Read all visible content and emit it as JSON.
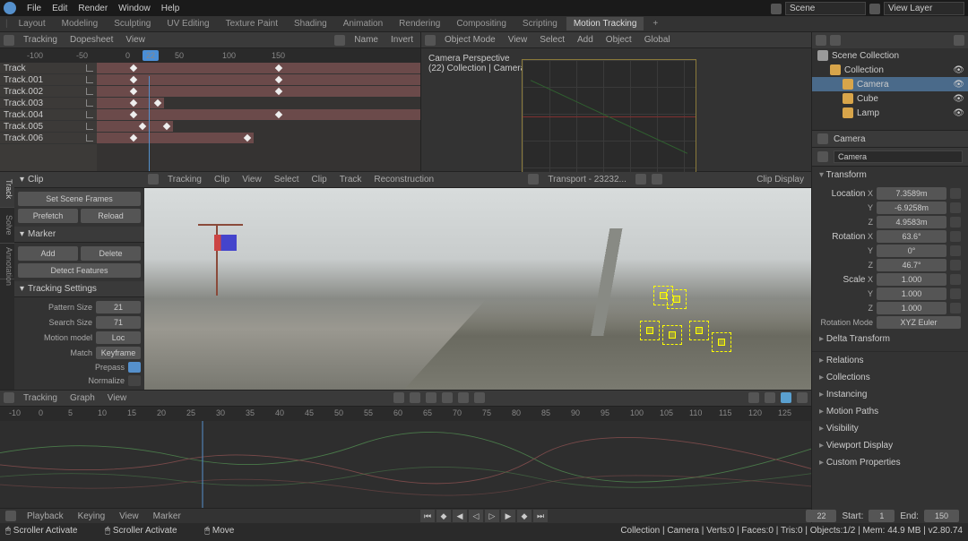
{
  "menu": {
    "file": "File",
    "edit": "Edit",
    "render": "Render",
    "window": "Window",
    "help": "Help"
  },
  "tabs": [
    "Layout",
    "Modeling",
    "Sculpting",
    "UV Editing",
    "Texture Paint",
    "Shading",
    "Animation",
    "Rendering",
    "Compositing",
    "Scripting",
    "Motion Tracking",
    "+"
  ],
  "active_tab": "Motion Tracking",
  "scene": {
    "label": "Scene",
    "viewlayer": "View Layer"
  },
  "dopesheet": {
    "mode": "Tracking",
    "sub": "Dopesheet",
    "view": "View",
    "name": "Name",
    "invert": "Invert",
    "frames": [
      "-100",
      "-50",
      "0",
      "50",
      "100",
      "150"
    ],
    "current": 22,
    "tracks": [
      "Track",
      "Track.001",
      "Track.002",
      "Track.003",
      "Track.004",
      "Track.005",
      "Track.006"
    ]
  },
  "viewport": {
    "mode": "Object Mode",
    "view": "View",
    "select": "Select",
    "add": "Add",
    "object": "Object",
    "orient": "Global",
    "persp": "Camera Perspective",
    "info": "(22) Collection | Camera"
  },
  "clip": {
    "mode": "Tracking",
    "sub": "Clip",
    "view": "View",
    "select": "Select",
    "clip_m": "Clip",
    "track": "Track",
    "reconstruction": "Reconstruction",
    "file": "Transport - 23232...",
    "display": "Clip Display",
    "side_tabs": [
      "Track",
      "Solve",
      "Annotation"
    ],
    "panel_clip": "Clip",
    "set_scene": "Set Scene Frames",
    "prefetch": "Prefetch",
    "reload": "Reload",
    "panel_marker": "Marker",
    "add": "Add",
    "delete": "Delete",
    "detect": "Detect Features",
    "panel_ts": "Tracking Settings",
    "pattern_size": "Pattern Size",
    "pattern_size_v": "21",
    "search_size": "Search Size",
    "search_size_v": "71",
    "motion_model": "Motion model",
    "motion_model_v": "Loc",
    "match": "Match",
    "match_v": "Keyframe",
    "prepass": "Prepass",
    "normalize": "Normalize"
  },
  "graph": {
    "mode": "Tracking",
    "sub": "Graph",
    "view": "View",
    "ruler": [
      "-10",
      "0",
      "5",
      "10",
      "15",
      "20",
      "25",
      "30",
      "35",
      "40",
      "45",
      "50",
      "55",
      "60",
      "65",
      "70",
      "75",
      "80",
      "85",
      "90",
      "95",
      "100",
      "105",
      "110",
      "115",
      "120",
      "125"
    ]
  },
  "playback": {
    "playback": "Playback",
    "keying": "Keying",
    "view": "View",
    "marker": "Marker",
    "frame": 22,
    "start_l": "Start:",
    "start": 1,
    "end_l": "End:",
    "end": 150
  },
  "status": {
    "left": "Scroller Activate",
    "mid": "Scroller Activate",
    "right": "Move",
    "info": "Collection | Camera | Verts:0 | Faces:0 | Tris:0 | Objects:1/2 | Mem: 44.9 MB | v2.80.74"
  },
  "outliner": {
    "title": "Scene Collection",
    "items": [
      {
        "label": "Collection",
        "icon": "#d8a54a",
        "indent": 1
      },
      {
        "label": "Camera",
        "icon": "#d8a54a",
        "indent": 2,
        "sel": true
      },
      {
        "label": "Cube",
        "icon": "#d8a54a",
        "indent": 2
      },
      {
        "label": "Lamp",
        "icon": "#d8a54a",
        "indent": 2
      }
    ]
  },
  "properties": {
    "name": "Camera",
    "transform": "Transform",
    "loc": "Location",
    "locX": "7.3589m",
    "locY": "-6.9258m",
    "locZ": "4.9583m",
    "rot": "Rotation",
    "rotX": "63.6°",
    "rotY": "0°",
    "rotZ": "46.7°",
    "scale": "Scale",
    "scaleX": "1.000",
    "scaleY": "1.000",
    "scaleZ": "1.000",
    "rotmode": "Rotation Mode",
    "rotmode_v": "XYZ Euler",
    "delta": "Delta Transform",
    "sections": [
      "Relations",
      "Collections",
      "Instancing",
      "Motion Paths",
      "Visibility",
      "Viewport Display",
      "Custom Properties"
    ]
  }
}
